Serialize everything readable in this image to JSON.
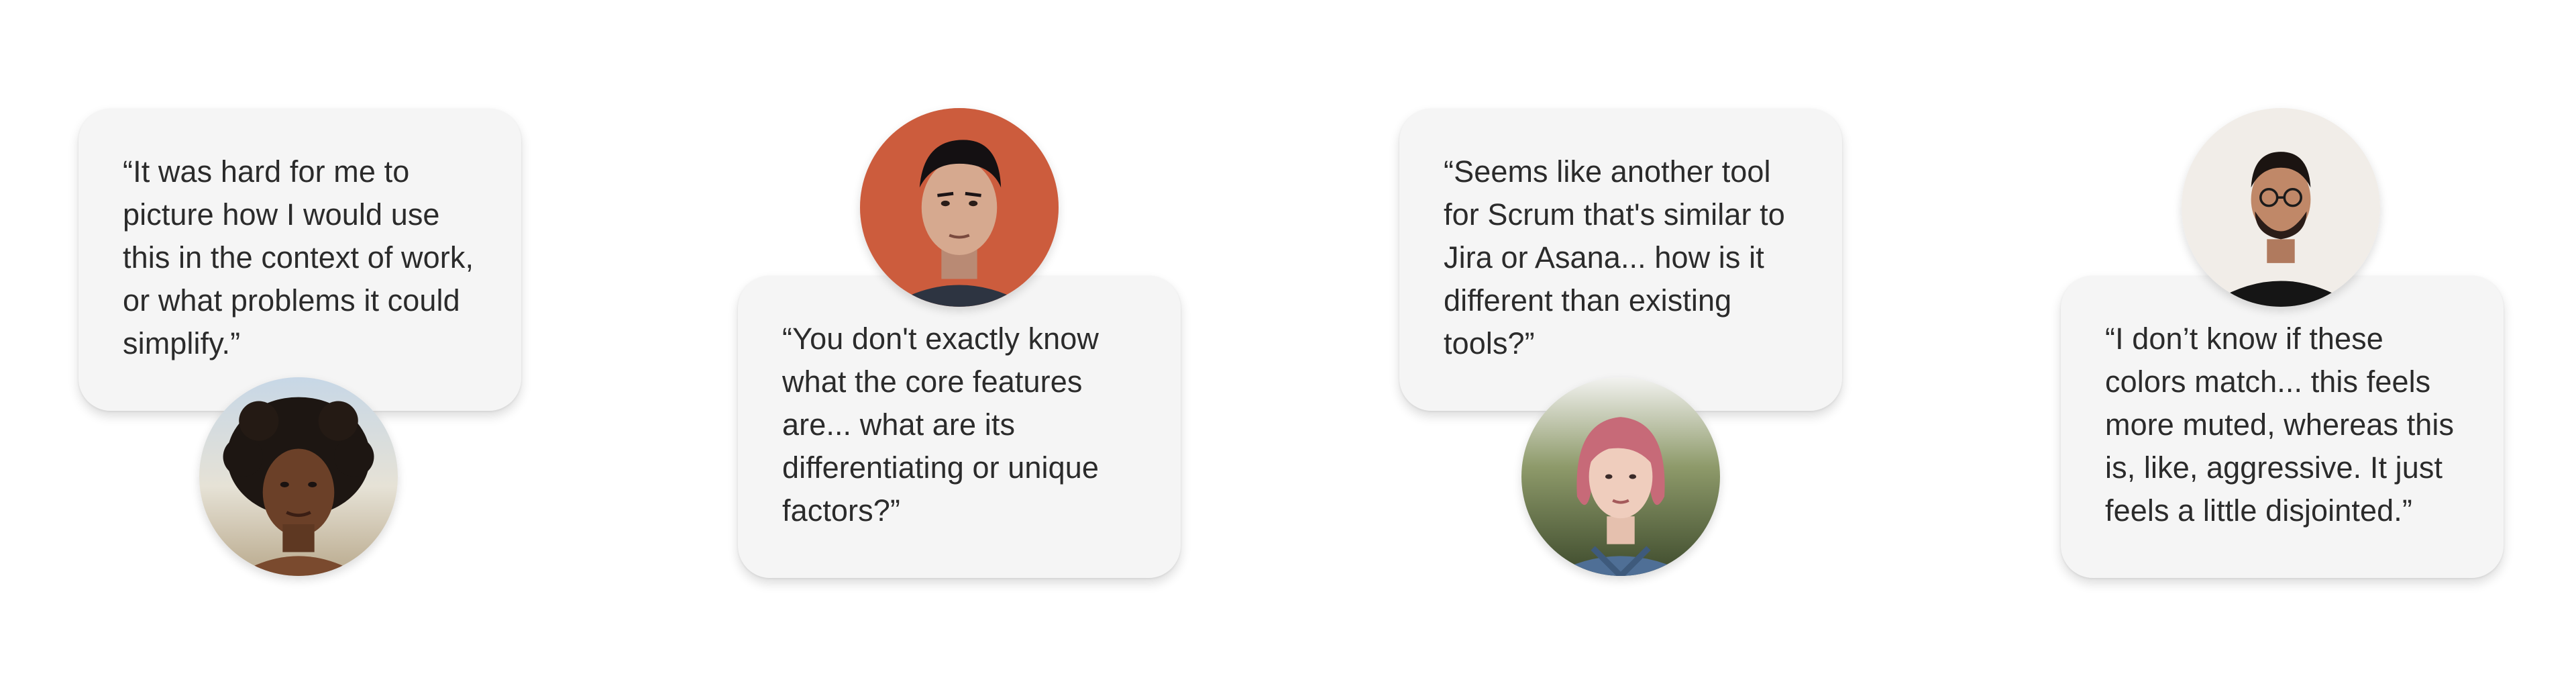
{
  "testimonials": [
    {
      "quote": "“It was hard for me to picture how I would use this in the context of work, or what problems it could simplify.”",
      "avatar_icon": "user-photo"
    },
    {
      "quote": "“You don't exactly know what the core features are... what are its differentiating or unique factors?”",
      "avatar_icon": "user-photo"
    },
    {
      "quote": "“Seems like another tool for Scrum that's similar to Jira or Asana... how is it different than existing tools?”",
      "avatar_icon": "user-photo"
    },
    {
      "quote": "“I don’t know if these colors match... this feels more muted, whereas this is, like, aggressive. It just feels a little disjointed.”",
      "avatar_icon": "user-photo"
    }
  ],
  "colors": {
    "card_bg": "#f5f5f5",
    "text": "#2b2b2b",
    "page_bg": "#ffffff"
  }
}
